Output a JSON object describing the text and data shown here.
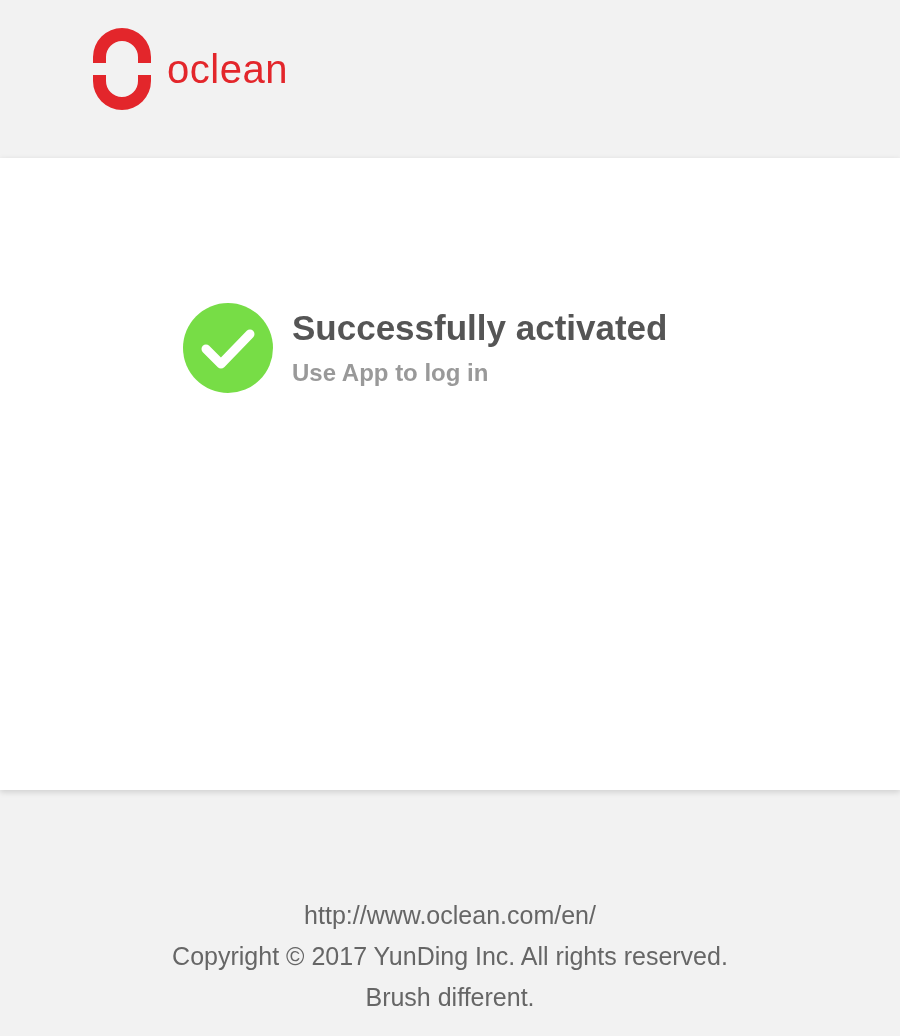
{
  "header": {
    "logo_text": "oclean"
  },
  "status": {
    "title": "Successfully activated",
    "subtitle": "Use App to log in"
  },
  "footer": {
    "lines": [
      "http://www.oclean.com/en/",
      "Copyright © 2017 YunDing Inc. All rights reserved.",
      "Brush different."
    ]
  }
}
